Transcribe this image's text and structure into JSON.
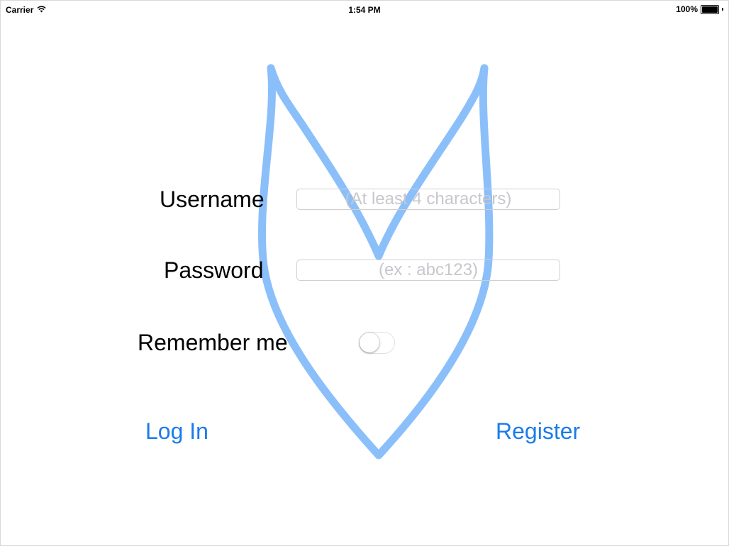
{
  "status_bar": {
    "carrier": "Carrier",
    "time": "1:54 PM",
    "battery_text": "100%",
    "signal_icon": "wifi-icon",
    "battery_icon": "battery-icon"
  },
  "logo": {
    "icon": "v-shield-logo",
    "color": "#8bbffa"
  },
  "form": {
    "username_label": "Username",
    "username_placeholder": "(At least 4 characters)",
    "username_value": "",
    "password_label": "Password",
    "password_placeholder": "(ex : abc123)",
    "password_value": "",
    "remember_label": "Remember me",
    "remember_on": false
  },
  "actions": {
    "login_label": "Log In",
    "register_label": "Register",
    "accent_color": "#1a7cea"
  }
}
